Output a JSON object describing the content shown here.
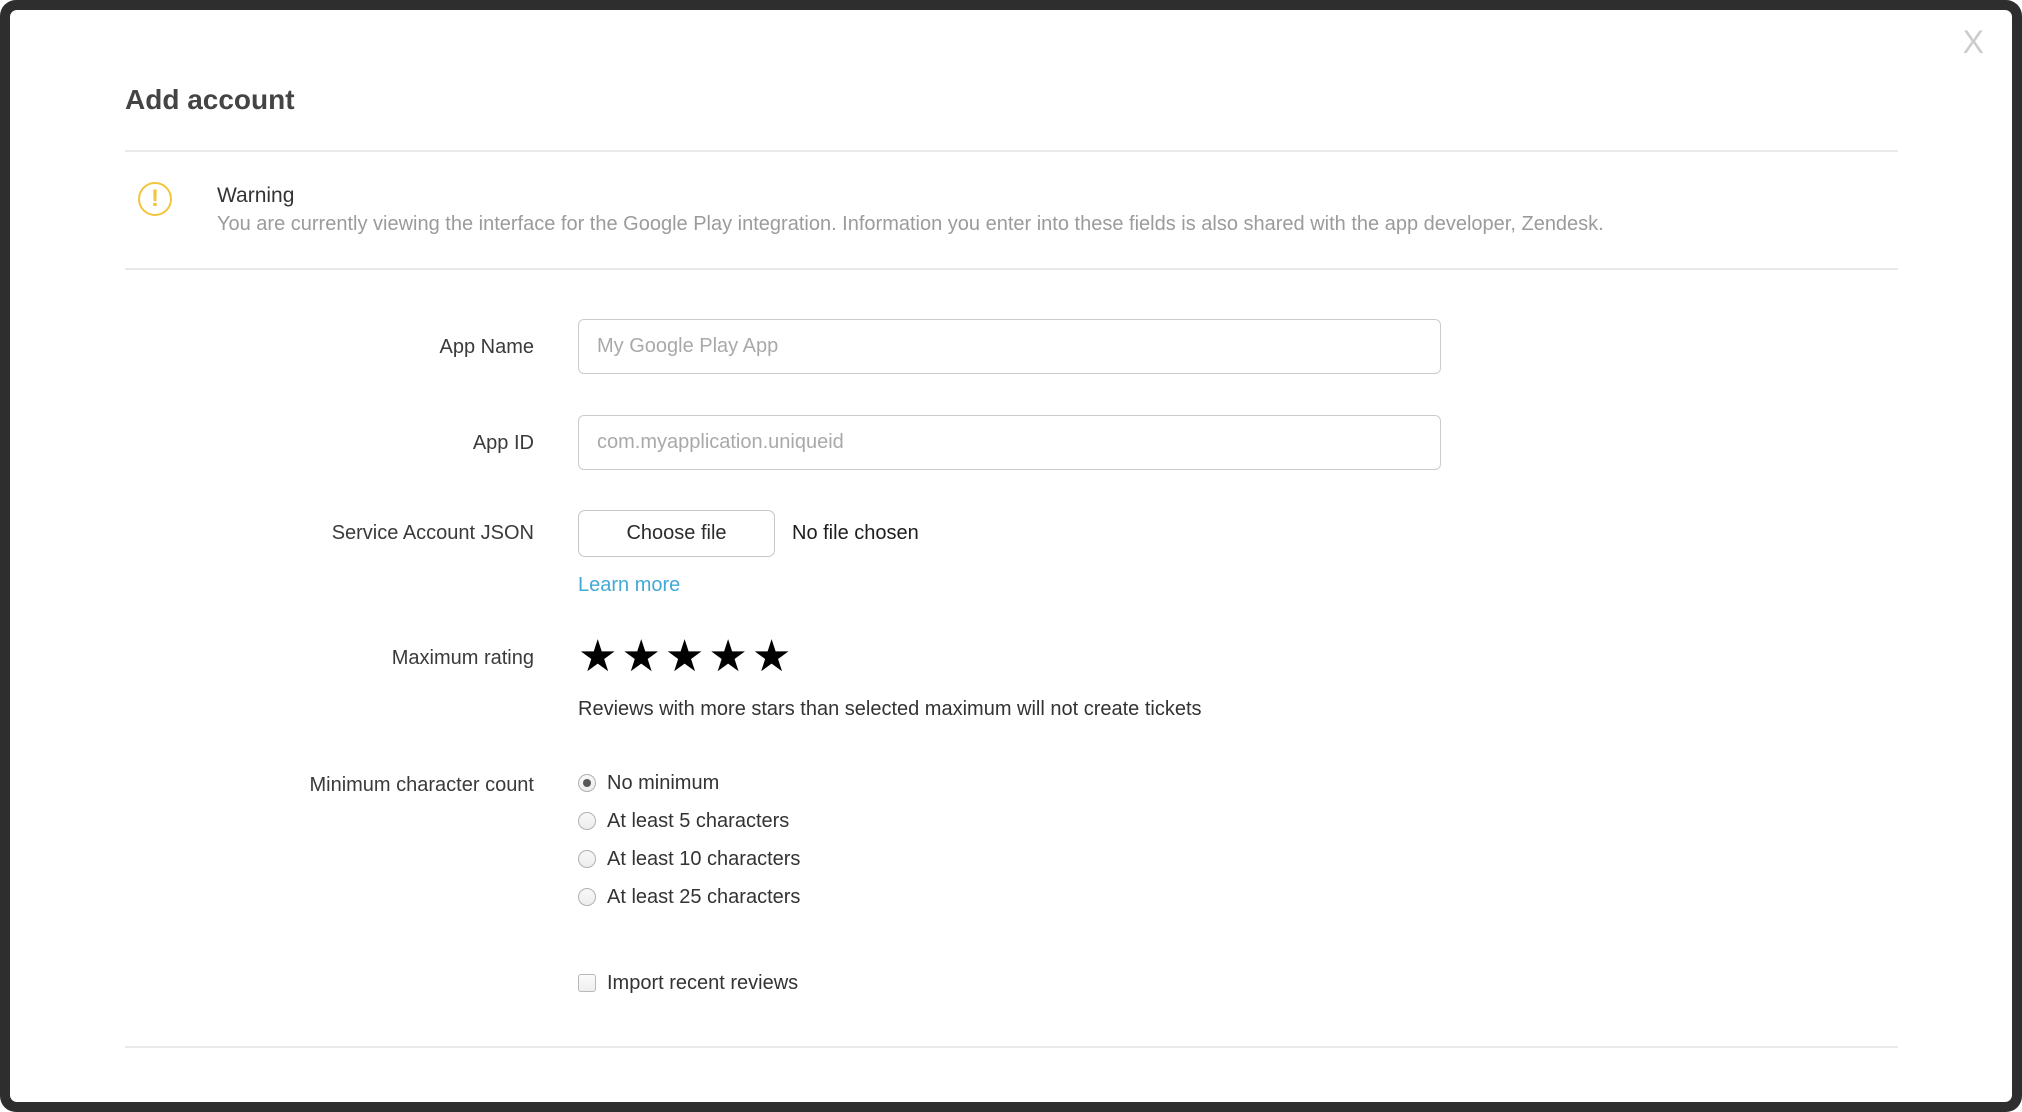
{
  "modal": {
    "title": "Add account",
    "close_label": "X"
  },
  "warning": {
    "icon_glyph": "!",
    "title": "Warning",
    "body": "You are currently viewing the interface for the Google Play integration. Information you enter into these fields is also shared with the app developer, Zendesk."
  },
  "form": {
    "app_name": {
      "label": "App Name",
      "value": "",
      "placeholder": "My Google Play App"
    },
    "app_id": {
      "label": "App ID",
      "value": "",
      "placeholder": "com.myapplication.uniqueid"
    },
    "service_account_json": {
      "label": "Service Account JSON",
      "button_label": "Choose file",
      "status": "No file chosen",
      "link_label": "Learn more"
    },
    "maximum_rating": {
      "label": "Maximum rating",
      "star_glyph": "★",
      "stars_total": 5,
      "stars_selected": 5,
      "helper": "Reviews with more stars than selected maximum will not create tickets"
    },
    "minimum_character_count": {
      "label": "Minimum character count",
      "options": [
        {
          "label": "No minimum",
          "selected": true
        },
        {
          "label": "At least 5 characters",
          "selected": false
        },
        {
          "label": "At least 10 characters",
          "selected": false
        },
        {
          "label": "At least 25 characters",
          "selected": false
        }
      ]
    },
    "import_recent_reviews": {
      "label": "Import recent reviews",
      "checked": false
    }
  },
  "colors": {
    "frame": "#2e2e2e",
    "link": "#42a9d6",
    "warning_icon": "#f2c53d",
    "star": "#000000",
    "divider": "#e9e9e9"
  }
}
